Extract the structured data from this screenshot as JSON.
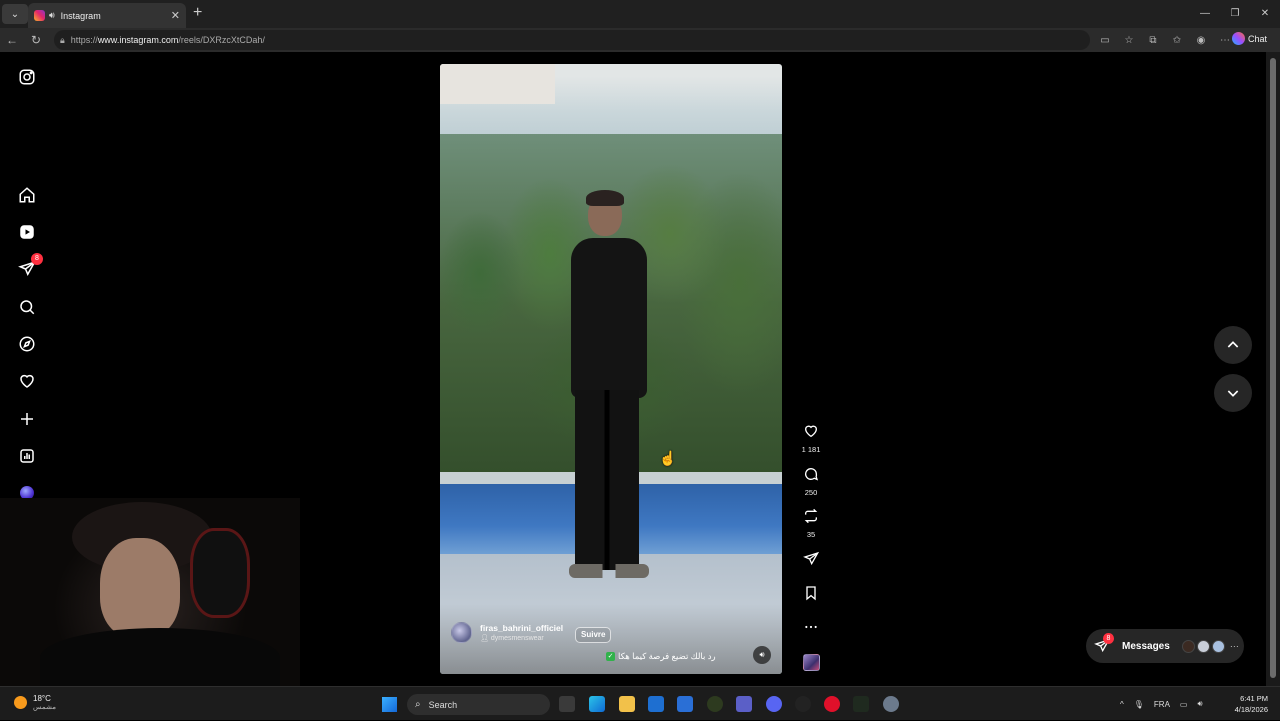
{
  "browser": {
    "tab_title": "Instagram",
    "url_prefix": "https://",
    "url_host": "www.instagram.com",
    "url_path": "/reels/DXRzcXtCDah/",
    "chat_label": "Chat"
  },
  "sidebar": {
    "notification_badge": "8"
  },
  "reel": {
    "username": "firas_bahrini_officiel",
    "collaborator": "dymesmenswear",
    "follow_label": "Suivre",
    "caption": "رد بالك تضيع فرصة كيما هكا",
    "likes": "1 181",
    "comments": "250",
    "reposts": "35"
  },
  "messages": {
    "label": "Messages",
    "badge": "8"
  },
  "taskbar": {
    "temperature": "18°C",
    "condition": "مشمس",
    "search_placeholder": "Search",
    "language": "FRA",
    "time": "6:41 PM",
    "date": "4/18/2026"
  }
}
